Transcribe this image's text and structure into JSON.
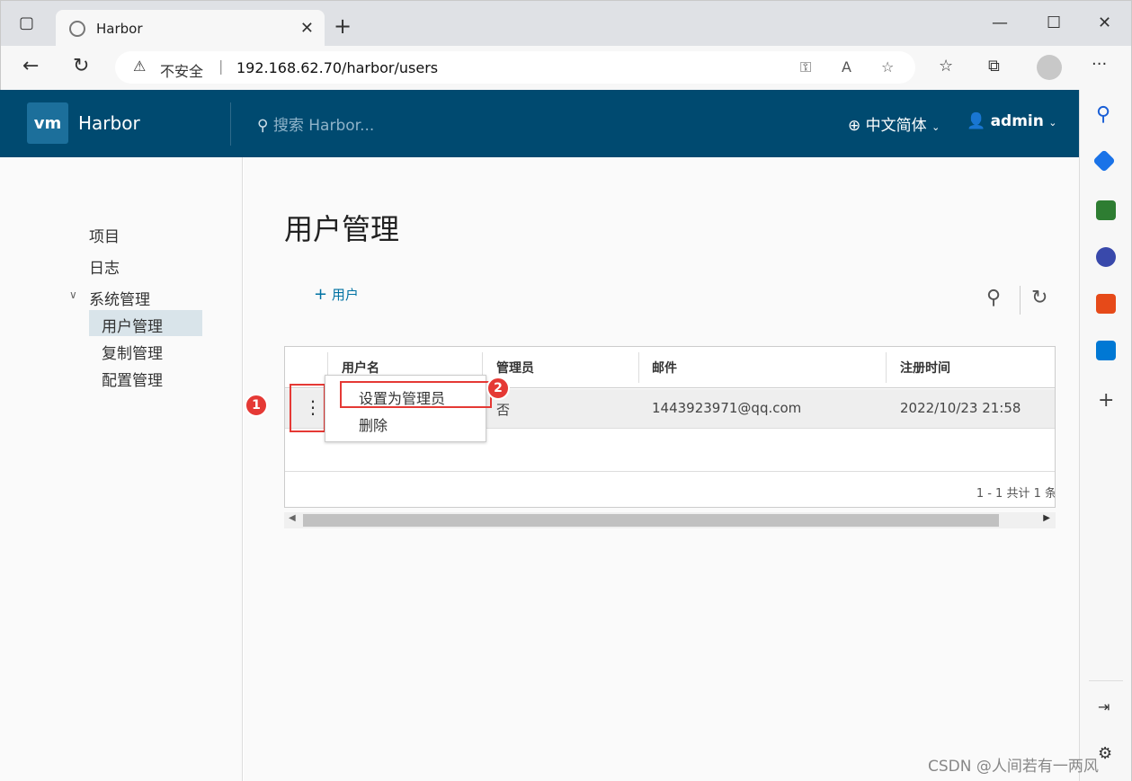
{
  "browser": {
    "tab_title": "Harbor",
    "url": "192.168.62.70/harbor/users",
    "security_label": "不安全",
    "new_tab": "+",
    "tab_close": "✕"
  },
  "header": {
    "logo_text": "vm",
    "brand": "Harbor",
    "search_placeholder": "搜索 Harbor...",
    "language": "中文简体",
    "user": "admin"
  },
  "sidebar": {
    "items": [
      {
        "label": "项目"
      },
      {
        "label": "日志"
      },
      {
        "label": "系统管理"
      },
      {
        "label": "用户管理"
      },
      {
        "label": "复制管理"
      },
      {
        "label": "配置管理"
      }
    ]
  },
  "main": {
    "title": "用户管理",
    "add_user": "用户",
    "columns": [
      "用户名",
      "管理员",
      "邮件",
      "注册时间"
    ],
    "rows": [
      {
        "admin": "否",
        "email": "1443923971@qq.com",
        "registered": "2022/10/23 21:58"
      }
    ],
    "pager": "1 - 1 共计 1 条"
  },
  "row_menu": {
    "set_admin": "设置为管理员",
    "delete": "删除"
  },
  "annotations": {
    "badge1": "1",
    "badge2": "2"
  },
  "watermark": "CSDN @人间若有一两风",
  "colors": {
    "header_bg": "#004a70",
    "accent": "#0072a3",
    "highlight": "#e53935"
  }
}
